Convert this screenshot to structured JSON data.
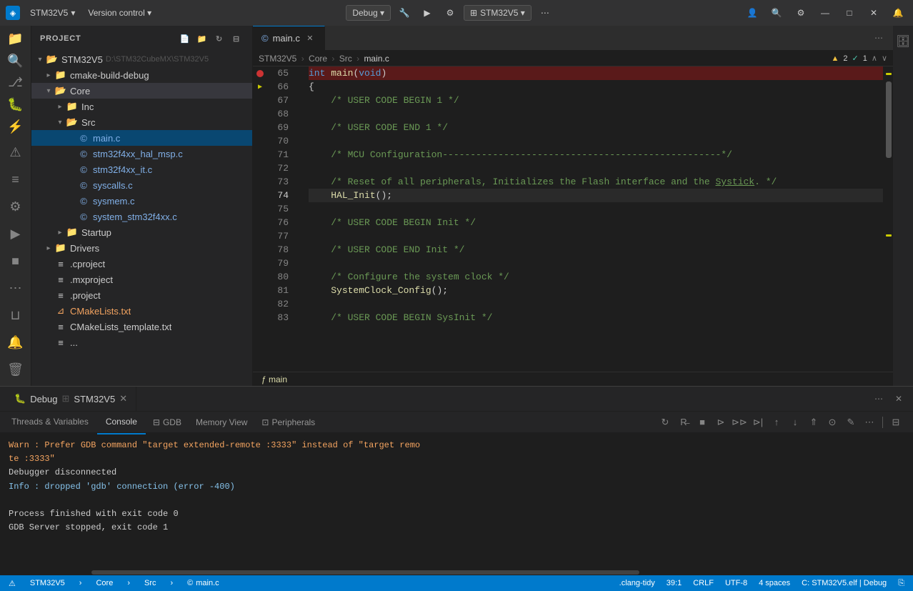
{
  "titlebar": {
    "icon": "◈",
    "project": "STM32V5",
    "menu_items": [
      "Version control ▾"
    ],
    "debug_label": "Debug ▾",
    "target_icon": "⊞",
    "target_label": "STM32V5 ▾",
    "actions": [
      "🔧",
      "▶",
      "⚙",
      "⋯"
    ],
    "window_controls": [
      "—",
      "□",
      "✕"
    ]
  },
  "sidebar": {
    "header": "Project",
    "tree": [
      {
        "id": "stm32v5-root",
        "label": "STM32V5",
        "suffix": " D:\\STM32CubeMX\\STM32V5",
        "indent": 0,
        "type": "folder-open",
        "expanded": true
      },
      {
        "id": "cmake-build",
        "label": "cmake-build-debug",
        "indent": 1,
        "type": "folder",
        "expanded": false
      },
      {
        "id": "core",
        "label": "Core",
        "indent": 1,
        "type": "folder-open",
        "expanded": true
      },
      {
        "id": "inc",
        "label": "Inc",
        "indent": 2,
        "type": "folder",
        "expanded": false
      },
      {
        "id": "src",
        "label": "Src",
        "indent": 2,
        "type": "folder-open",
        "expanded": true
      },
      {
        "id": "main-c",
        "label": "main.c",
        "indent": 3,
        "type": "file-c",
        "active": true
      },
      {
        "id": "stm32f4xx-hal",
        "label": "stm32f4xx_hal_msp.c",
        "indent": 3,
        "type": "file-c"
      },
      {
        "id": "stm32f4xx-it",
        "label": "stm32f4xx_it.c",
        "indent": 3,
        "type": "file-c"
      },
      {
        "id": "syscalls",
        "label": "syscalls.c",
        "indent": 3,
        "type": "file-c"
      },
      {
        "id": "sysmem",
        "label": "sysmem.c",
        "indent": 3,
        "type": "file-c"
      },
      {
        "id": "system-stm32",
        "label": "system_stm32f4xx.c",
        "indent": 3,
        "type": "file-c"
      },
      {
        "id": "startup",
        "label": "Startup",
        "indent": 2,
        "type": "folder",
        "expanded": false
      },
      {
        "id": "drivers",
        "label": "Drivers",
        "indent": 1,
        "type": "folder",
        "expanded": false
      },
      {
        "id": "cproject",
        "label": ".cproject",
        "indent": 1,
        "type": "file-xml"
      },
      {
        "id": "mxproject",
        "label": ".mxproject",
        "indent": 1,
        "type": "file-xml"
      },
      {
        "id": "project",
        "label": ".project",
        "indent": 1,
        "type": "file-xml"
      },
      {
        "id": "cmakelists",
        "label": "CMakeLists.txt",
        "indent": 1,
        "type": "file-cmake"
      },
      {
        "id": "cmakelists-template",
        "label": "CMakeLists_template.txt",
        "indent": 1,
        "type": "file-xml"
      },
      {
        "id": "more-files",
        "label": "...",
        "indent": 1,
        "type": "file-xml"
      }
    ]
  },
  "editor": {
    "tab_label": "main.c",
    "lines": [
      {
        "num": 65,
        "content": "int main(void)",
        "highlight": "breakpoint-current"
      },
      {
        "num": 66,
        "content": "{"
      },
      {
        "num": 67,
        "content": "    /* USER CODE BEGIN 1 */",
        "type": "comment"
      },
      {
        "num": 68,
        "content": ""
      },
      {
        "num": 69,
        "content": "    /* USER CODE END 1 */",
        "type": "comment"
      },
      {
        "num": 70,
        "content": ""
      },
      {
        "num": 71,
        "content": "    /* MCU Configuration--------------------------------------------------*/",
        "type": "comment"
      },
      {
        "num": 72,
        "content": ""
      },
      {
        "num": 73,
        "content": "    /* Reset of all peripherals, Initializes the Flash interface and the Systick. */",
        "type": "comment"
      },
      {
        "num": 74,
        "content": "    HAL_Init();",
        "type": "current"
      },
      {
        "num": 75,
        "content": ""
      },
      {
        "num": 76,
        "content": "    /* USER CODE BEGIN Init */",
        "type": "comment"
      },
      {
        "num": 77,
        "content": ""
      },
      {
        "num": 78,
        "content": "    /* USER CODE END Init */",
        "type": "comment"
      },
      {
        "num": 79,
        "content": ""
      },
      {
        "num": 80,
        "content": "    /* Configure the system clock */",
        "type": "comment"
      },
      {
        "num": 81,
        "content": "    SystemClock_Config();"
      },
      {
        "num": 82,
        "content": ""
      },
      {
        "num": 83,
        "content": "    /* USER CODE BEGIN SysInit */",
        "type": "comment"
      }
    ],
    "warning_count": "▲ 2",
    "error_count": "✓ 1",
    "breadcrumb": [
      "STM32V5",
      "Core",
      "Src",
      "main.c"
    ],
    "function_label": "ƒ main"
  },
  "debug_panel": {
    "title": "Debug",
    "target": "STM32V5",
    "tabs": [
      "Threads & Variables",
      "Console",
      "GDB",
      "Memory View",
      "Peripherals"
    ],
    "active_tab": "Console",
    "toolbar_buttons": [
      "↻",
      "R̶",
      "■",
      "⊳",
      "⊳⊳",
      "⊳|",
      "⇧",
      "⇩",
      "⇧⇧",
      "⊙",
      "✎",
      "⋯"
    ],
    "messages": [
      {
        "type": "warn",
        "text": "Warn : Prefer GDB command \"target extended-remote :3333\" instead of \"target remo"
      },
      {
        "type": "warn",
        "text": "te :3333\""
      },
      {
        "type": "normal",
        "text": "Debugger disconnected"
      },
      {
        "type": "info",
        "text": "Info : dropped 'gdb' connection (error -400)"
      },
      {
        "type": "normal",
        "text": ""
      },
      {
        "type": "normal",
        "text": "Process finished with exit code 0"
      },
      {
        "type": "normal",
        "text": "GDB Server stopped, exit code 1"
      }
    ]
  },
  "statusbar": {
    "left": [
      {
        "icon": "⚠",
        "label": "STM32V5"
      },
      {
        "label": "Core > Src"
      },
      {
        "icon": "©",
        "label": "main.c"
      }
    ],
    "right": [
      {
        "label": ".clang-tidy"
      },
      {
        "label": "39:1"
      },
      {
        "label": "CRLF"
      },
      {
        "label": "UTF-8"
      },
      {
        "label": "4 spaces"
      },
      {
        "label": "C: STM32V5.elf | Debug"
      },
      {
        "icon": "⎘"
      }
    ]
  },
  "activity": {
    "top": [
      "📁",
      "🔍",
      "⎇",
      "🐛",
      "⚡"
    ],
    "bottom": [
      "⚠",
      "≡",
      "⚙",
      "▶",
      "□",
      "⋮",
      "⊔",
      "🔔",
      "🗑"
    ]
  }
}
